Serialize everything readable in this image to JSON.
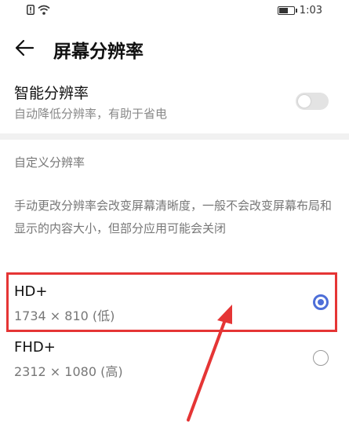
{
  "status_bar": {
    "time": "1:03",
    "battery_level": 0.65
  },
  "header": {
    "title": "屏幕分辨率"
  },
  "smart_resolution": {
    "title": "智能分辨率",
    "subtitle": "自动降低分辨率，有助于省电",
    "enabled": false
  },
  "custom": {
    "section_label": "自定义分辨率",
    "description": "手动更改分辨率会改变屏幕清晰度，一般不会改变屏幕布局和显示的内容大小，但部分应用可能会关闭"
  },
  "options": [
    {
      "title": "HD+",
      "subtitle": "1734 × 810 (低)",
      "selected": true
    },
    {
      "title": "FHD+",
      "subtitle": "2312 × 1080 (高)",
      "selected": false
    }
  ],
  "colors": {
    "accent": "#4d6ed8",
    "annotation": "#e53535"
  }
}
